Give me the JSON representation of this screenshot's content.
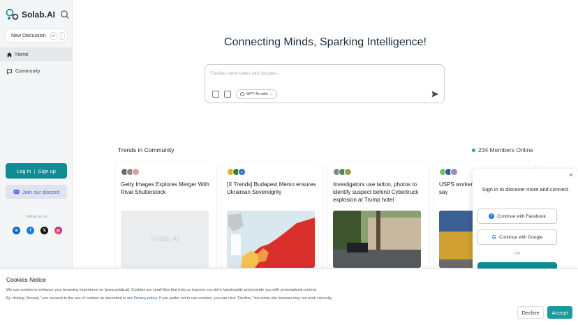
{
  "brand": {
    "name": "Solab.AI",
    "accent": "#0f8c94"
  },
  "sidebar": {
    "new_discussion": "New Discussion",
    "shortcut_keys": [
      "⌘",
      "I"
    ],
    "nav": [
      {
        "label": "Home",
        "icon": "home-icon",
        "active": true
      },
      {
        "label": "Community",
        "icon": "community-icon",
        "active": false
      }
    ],
    "login": "Log in",
    "signup": "Sign up",
    "discord": "Join our discord",
    "follow_us": "Follow us on",
    "socials": [
      "linkedin-icon",
      "facebook-icon",
      "x-icon",
      "instagram-icon"
    ]
  },
  "main": {
    "headline": "Connecting Minds, Sparking Intelligence!",
    "prompt": {
      "placeholder": "Families name tables with Socrates...",
      "model": "GPT-4o mini"
    },
    "trends_title": "Trends in Community",
    "members_online": "234 Members Online",
    "cards": [
      {
        "title": "Getty Images Explores Merger With Rival Shutterstock",
        "image": "Solab.AI"
      },
      {
        "title": "[X Trends] Budapest Memo ensures Ukrainian Sovereignty",
        "image": "map"
      },
      {
        "title": "Investigators use tattoo, photos to identify suspect behind Cybertruck explosion at Trump hotel",
        "image": "street"
      },
      {
        "title": "USPS worker shot in Harlem, police say",
        "image": "storefront"
      }
    ]
  },
  "signin": {
    "close": "×",
    "title": "Sign in to discover more and connect",
    "facebook": "Continue with Facebook",
    "google": "Continue with Google",
    "or": "OR"
  },
  "cookies": {
    "title": "Cookies Notice",
    "line1": "We use cookies to enhance your browsing experience on [www.solab.ai]. Cookies are small files that help us improve our site's functionality and provide you with personalized content.",
    "line2_pre": "By clicking \"Accept,\" you consent to the use of cookies as described in our",
    "line2_link": "Privacy policy",
    "line2_post": ". If you prefer not to use cookies, you can click \"Decline,\" but some site features may not work correctly.",
    "decline": "Decline",
    "accept": "Accept"
  }
}
